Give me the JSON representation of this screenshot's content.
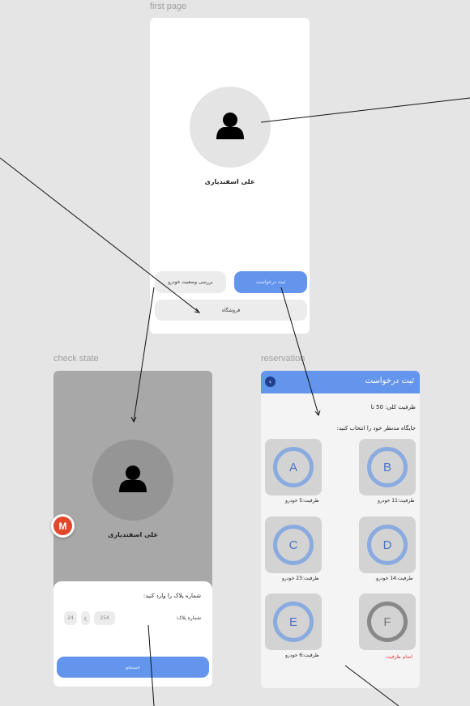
{
  "frames": {
    "first_page": "first page",
    "check_state": "check state",
    "reservation": "reservation"
  },
  "user": {
    "name": "علی اسفندیاری"
  },
  "first_page": {
    "submit_label": "ثبت درخواست",
    "check_label": "بررسی وضعیت خودرو",
    "store_label": "فروشگاه"
  },
  "check_state": {
    "badge": "M",
    "sheet_title": "شماره پلاک را وارد کنید:",
    "plate_label": "شماره پلاک:",
    "plate_fields": [
      "254",
      "ع",
      "24"
    ],
    "search_label": "جستجو"
  },
  "reservation": {
    "header_title": "ثبت درخواست",
    "back_icon": "chevron-left-icon",
    "capacity_total": "ظرفیت کلی: 50 تا",
    "choose_slot": "جایگاه مدنظر خود را انتخاب کنید:",
    "slots": [
      {
        "letter": "A",
        "caption": "ظرفیت:5 خودرو",
        "full": false
      },
      {
        "letter": "B",
        "caption": "ظرفیت:11 خودرو",
        "full": false
      },
      {
        "letter": "C",
        "caption": "ظرفیت:23 خودرو",
        "full": false
      },
      {
        "letter": "D",
        "caption": "ظرفیت:14 خودرو",
        "full": false
      },
      {
        "letter": "E",
        "caption": "ظرفیت:6 خودرو",
        "full": false
      },
      {
        "letter": "F",
        "caption": "اتمام ظرفیت",
        "full": true
      }
    ]
  },
  "colors": {
    "accent": "#6495ed",
    "header_dark": "#1f3f8f",
    "ring": "#8aabdf",
    "full_text": "#e03a3a",
    "badge": "#e2472a"
  }
}
